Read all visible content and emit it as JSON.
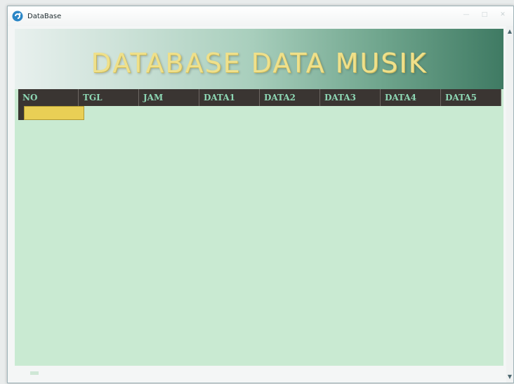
{
  "window": {
    "title": "DataBase",
    "icon": "app-logo-icon",
    "controls": [
      "minimize",
      "maximize",
      "close"
    ],
    "control_glyphs": [
      "—",
      "□",
      "✕"
    ]
  },
  "banner": {
    "title": "DATABASE DATA MUSIK",
    "title_color": "#efe08a"
  },
  "grid": {
    "columns": [
      "NO",
      "TGL",
      "JAM",
      "DATA1",
      "DATA2",
      "DATA3",
      "DATA4",
      "DATA5"
    ],
    "header_bg": "#3a3532",
    "header_text_color": "#8dd7b4",
    "active_cell_color": "#e9cf55",
    "rows": []
  },
  "colors": {
    "client_bg": "#c9ead2"
  }
}
